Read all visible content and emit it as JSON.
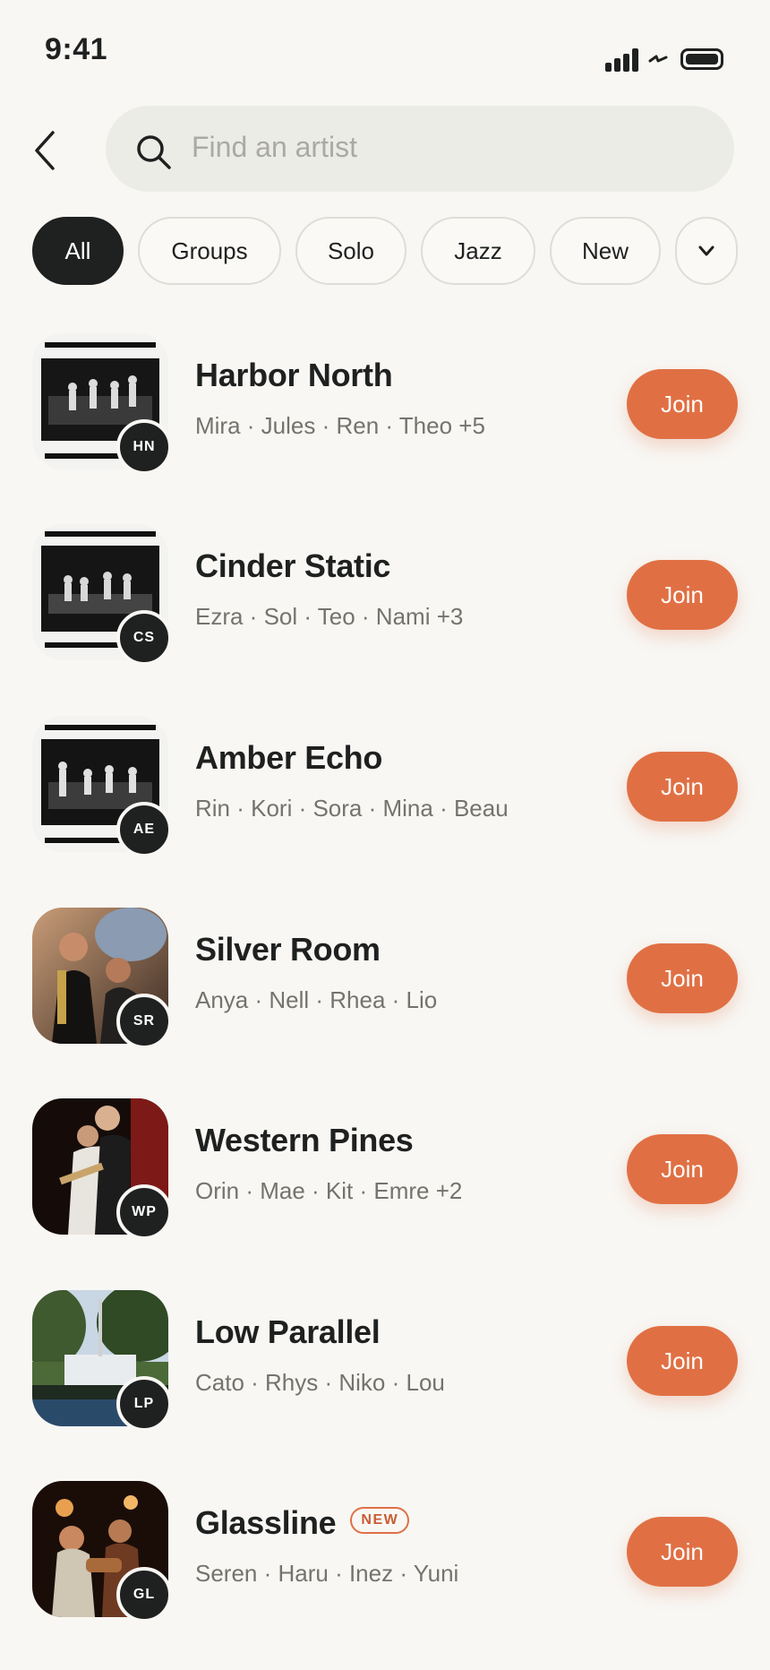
{
  "status": {
    "time": "9:41"
  },
  "search": {
    "placeholder": "Find an artist"
  },
  "filters": [
    {
      "label": "All",
      "active": true
    },
    {
      "label": "Groups",
      "active": false
    },
    {
      "label": "Solo",
      "active": false
    },
    {
      "label": "Jazz",
      "active": false
    },
    {
      "label": "New",
      "active": false
    }
  ],
  "artists": [
    {
      "name": "Harbor North",
      "initials": "HN",
      "members": "Mira · Jules · Ren · Theo +5",
      "join_label": "Join",
      "thumb_style": "bw-stage"
    },
    {
      "name": "Cinder Static",
      "initials": "CS",
      "members": "Ezra · Sol · Teo · Nami +3",
      "join_label": "Join",
      "thumb_style": "bw-stage"
    },
    {
      "name": "Amber Echo",
      "initials": "AE",
      "members": "Rin · Kori · Sora · Mina · Beau",
      "join_label": "Join",
      "thumb_style": "bw-stage"
    },
    {
      "name": "Silver Room",
      "initials": "SR",
      "members": "Anya · Nell · Rhea · Lio",
      "join_label": "Join",
      "thumb_style": "sax-photo"
    },
    {
      "name": "Western Pines",
      "initials": "WP",
      "members": "Orin · Mae · Kit · Emre +2",
      "join_label": "Join",
      "thumb_style": "red-stage"
    },
    {
      "name": "Low Parallel",
      "initials": "LP",
      "members": "Cato · Rhys · Niko · Lou",
      "join_label": "Join",
      "thumb_style": "outdoor"
    },
    {
      "name": "Glassline",
      "initials": "GL",
      "members": "Seren · Haru · Inez · Yuni",
      "join_label": "Join",
      "thumb_style": "warm-club",
      "tag": "NEW"
    }
  ],
  "colors": {
    "accent": "#e07044",
    "dark": "#1f2120",
    "background": "#f8f7f4"
  }
}
